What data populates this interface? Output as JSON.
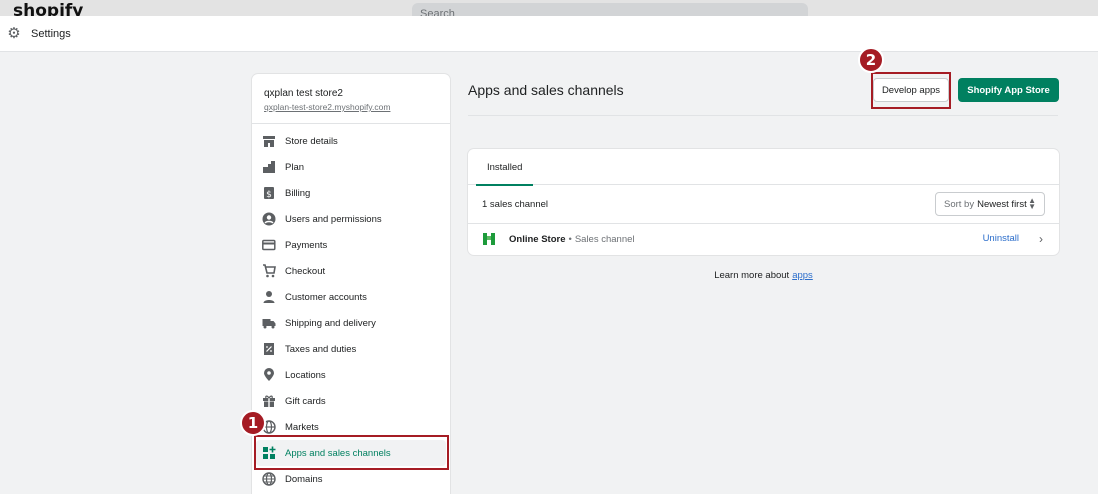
{
  "topbar": {
    "brand": "shopify",
    "search_placeholder": "Search"
  },
  "header": {
    "title": "Settings"
  },
  "store": {
    "name": "qxplan test store2",
    "url": "qxplan-test-store2.myshopify.com"
  },
  "sidebar": {
    "items": [
      {
        "label": "Store details",
        "icon": "store-icon"
      },
      {
        "label": "Plan",
        "icon": "plan-icon"
      },
      {
        "label": "Billing",
        "icon": "billing-icon"
      },
      {
        "label": "Users and permissions",
        "icon": "user-circle-icon"
      },
      {
        "label": "Payments",
        "icon": "payments-icon"
      },
      {
        "label": "Checkout",
        "icon": "cart-icon"
      },
      {
        "label": "Customer accounts",
        "icon": "customer-icon"
      },
      {
        "label": "Shipping and delivery",
        "icon": "truck-icon"
      },
      {
        "label": "Taxes and duties",
        "icon": "tax-icon"
      },
      {
        "label": "Locations",
        "icon": "location-pin-icon"
      },
      {
        "label": "Gift cards",
        "icon": "gift-icon"
      },
      {
        "label": "Markets",
        "icon": "globe-icon"
      },
      {
        "label": "Apps and sales channels",
        "icon": "apps-icon"
      },
      {
        "label": "Domains",
        "icon": "globe-icon"
      }
    ],
    "active_index": 12
  },
  "main": {
    "title": "Apps and sales channels",
    "develop_label": "Develop apps",
    "appstore_label": "Shopify App Store",
    "tab_label": "Installed",
    "count_label": "1 sales channel",
    "sort_prefix": "Sort by",
    "sort_value": "Newest first",
    "app": {
      "name": "Online Store",
      "separator": "•",
      "type": "Sales channel",
      "action": "Uninstall"
    },
    "learn_text": "Learn more about",
    "learn_link": "apps"
  },
  "annotations": {
    "badge1": "1",
    "badge2": "2",
    "color": "#a51c24"
  },
  "colors": {
    "accent": "#008060",
    "link": "#2c6ecb"
  }
}
